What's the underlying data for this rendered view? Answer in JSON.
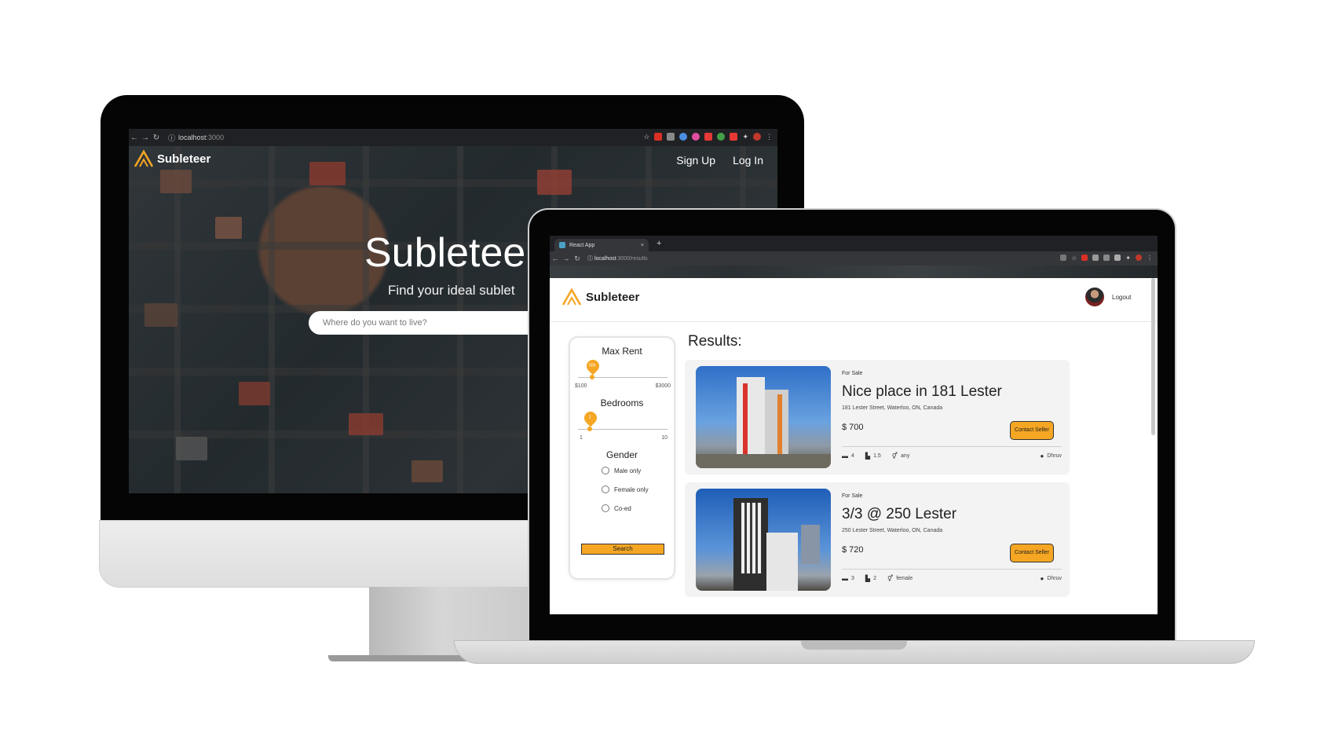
{
  "desktop": {
    "browser": {
      "url_host": "localhost",
      "url_port": ":3000"
    },
    "header": {
      "logo_text": "Subleteer",
      "nav": [
        "Sign Up",
        "Log In"
      ]
    },
    "hero": {
      "title": "Subleteer",
      "subtitle": "Find your ideal sublet",
      "search_placeholder": "Where do you want to live?"
    }
  },
  "laptop": {
    "browser": {
      "tab_title": "React App",
      "tab_close": "×",
      "new_tab": "+",
      "url_host": "localhost",
      "url_path": ":3000/results"
    },
    "header": {
      "logo_text": "Subleteer",
      "logout_label": "Logout"
    },
    "filters": {
      "max_rent": {
        "title": "Max Rent",
        "min_label": "$100",
        "max_label": "$3000",
        "value_label": "500"
      },
      "bedrooms": {
        "title": "Bedrooms",
        "min_label": "1",
        "max_label": "10",
        "value_label": "2"
      },
      "gender": {
        "title": "Gender",
        "options": [
          "Male only",
          "Female only",
          "Co-ed"
        ]
      },
      "search_label": "Search"
    },
    "results": {
      "title": "Results:",
      "listings": [
        {
          "type": "For Sale",
          "title": "Nice place in 181 Lester",
          "address": "181 Lester Street, Waterloo, ON, Canada",
          "price": "$ 700",
          "contact_label": "Contact Seller",
          "beds": "4",
          "baths": "1.5",
          "gender": "any",
          "owner": "Dhruv"
        },
        {
          "type": "For Sale",
          "title": "3/3 @ 250 Lester",
          "address": "250 Lester Street, Waterloo, ON, Canada",
          "price": "$ 720",
          "contact_label": "Contact Seller",
          "beds": "3",
          "baths": "2",
          "gender": "female",
          "owner": "Dhruv"
        }
      ]
    }
  },
  "colors": {
    "accent": "#f5a623",
    "chrome_dark": "#202124",
    "card_bg": "#f3f3f3"
  },
  "icons": [
    "back-arrow-icon",
    "forward-arrow-icon",
    "reload-icon",
    "info-icon",
    "star-icon",
    "puzzle-icon",
    "menu-dots-icon",
    "bed-icon",
    "bath-icon",
    "gender-icon",
    "person-icon",
    "logo-icon"
  ]
}
